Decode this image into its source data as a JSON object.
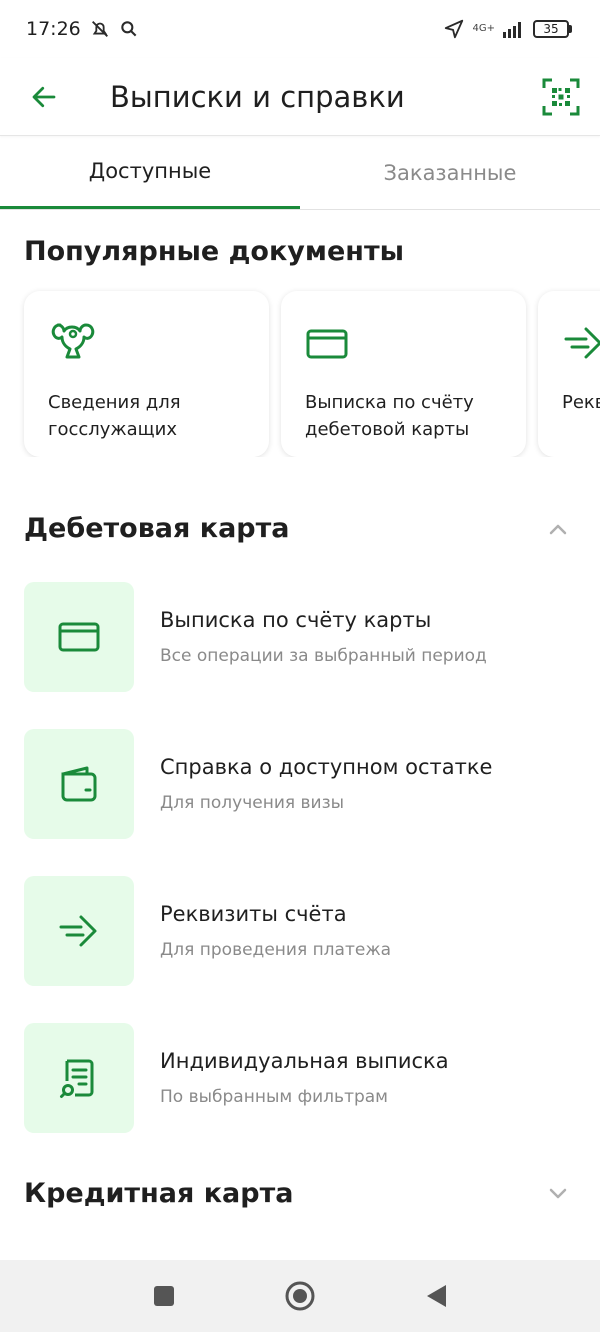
{
  "status_bar": {
    "time": "17:26",
    "network": "4G+",
    "battery": "35"
  },
  "app_bar": {
    "title": "Выписки и справки"
  },
  "tabs": [
    {
      "label": "Доступные",
      "active": true
    },
    {
      "label": "Заказанные",
      "active": false
    }
  ],
  "popular": {
    "title": "Популярные документы",
    "cards": [
      {
        "label": "Сведения для госслужащих",
        "icon": "emblem-icon"
      },
      {
        "label": "Выписка по счёту дебетовой карты",
        "icon": "card-icon"
      },
      {
        "label": "Реквизиты счёта",
        "icon": "transfer-arrow-icon"
      }
    ]
  },
  "debit_group": {
    "title": "Дебетовая карта",
    "items": [
      {
        "title": "Выписка по счёту карты",
        "subtitle": "Все операции за выбранный период",
        "icon": "card-icon"
      },
      {
        "title": "Справка о доступном остатке",
        "subtitle": "Для получения визы",
        "icon": "wallet-icon"
      },
      {
        "title": "Реквизиты счёта",
        "subtitle": "Для проведения платежа",
        "icon": "transfer-arrow-icon"
      },
      {
        "title": "Индивидуальная выписка",
        "subtitle": "По выбранным фильтрам",
        "icon": "document-search-icon"
      }
    ]
  },
  "credit_group": {
    "title": "Кредитная карта"
  },
  "colors": {
    "accent": "#1a8a3a",
    "icon_bg": "#e6fbe9",
    "secondary_text": "#8a8a8a"
  }
}
